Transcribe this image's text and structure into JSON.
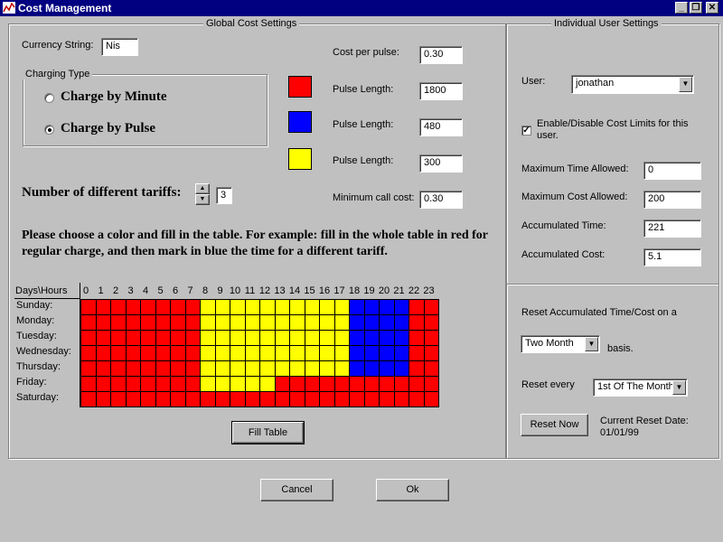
{
  "window": {
    "title": "Cost Management",
    "min_glyph": "_",
    "max_glyph": "❐",
    "close_glyph": "✕"
  },
  "global": {
    "legend": "Global Cost Settings",
    "currency_label": "Currency String:",
    "currency_value": "Nis",
    "charging_type_legend": "Charging Type",
    "charge_by_minute": "Charge by Minute",
    "charge_by_pulse": "Charge by Pulse",
    "selected_charging": "pulse",
    "cost_per_pulse_label": "Cost per pulse:",
    "cost_per_pulse": "0.30",
    "pulse_length_label": "Pulse Length:",
    "pulses": [
      {
        "color": "#ff0000",
        "value": "1800"
      },
      {
        "color": "#0000ff",
        "value": "480"
      },
      {
        "color": "#ffff00",
        "value": "300"
      }
    ],
    "min_call_cost_label": "Minimum call cost:",
    "min_call_cost": "0.30",
    "tariffs_label": "Number of different tariffs:",
    "tariffs_value": "3",
    "instructions": "Please choose a color and fill in the table. For example: fill in the whole table in red for regular charge, and then mark in blue the time for a different tariff.",
    "days_hours_label": "Days\\Hours",
    "hours": [
      "0",
      "1",
      "2",
      "3",
      "4",
      "5",
      "6",
      "7",
      "8",
      "9",
      "10",
      "11",
      "12",
      "13",
      "14",
      "15",
      "16",
      "17",
      "18",
      "19",
      "20",
      "21",
      "22",
      "23"
    ],
    "days": [
      "Sunday:",
      "Monday:",
      "Tuesday:",
      "Wednesday:",
      "Thursday:",
      "Friday:",
      "Saturday:"
    ],
    "grid": [
      "RRRRRRRRYYYYYYYYYYBBBBRR",
      "RRRRRRRRYYYYYYYYYYBBBBRR",
      "RRRRRRRRYYYYYYYYYYBBBBRR",
      "RRRRRRRRYYYYYYYYYYBBBBRR",
      "RRRRRRRRYYYYYYYYYYBBBBRR",
      "RRRRRRRRYYYYYRRRRRRRRRRR",
      "RRRRRRRRRRRRRRRRRRRRRRRR"
    ],
    "fill_table_label": "Fill Table"
  },
  "user": {
    "legend": "Individual User Settings",
    "user_label": "User:",
    "user_value": "jonathan",
    "enable_limits_label": "Enable/Disable Cost Limits for this user.",
    "enable_limits_checked": true,
    "max_time_label": "Maximum Time Allowed:",
    "max_time": "0",
    "max_cost_label": "Maximum Cost Allowed:",
    "max_cost": "200",
    "acc_time_label": "Accumulated Time:",
    "acc_time": "221",
    "acc_cost_label": "Accumulated Cost:",
    "acc_cost": "5.1",
    "reset_basis_label": "Reset Accumulated Time/Cost on a",
    "reset_basis_value": "Two Month",
    "basis_label": "basis.",
    "reset_every_label": "Reset every",
    "reset_every_value": "1st Of The Month",
    "reset_now_label": "Reset Now",
    "current_reset_label": "Current Reset Date:",
    "current_reset_date": "01/01/99"
  },
  "footer": {
    "cancel_label": "Cancel",
    "ok_label": "Ok"
  },
  "colors": {
    "red": "#ff0000",
    "yellow": "#ffff00",
    "blue": "#0000ff",
    "titlebar": "#000080"
  }
}
